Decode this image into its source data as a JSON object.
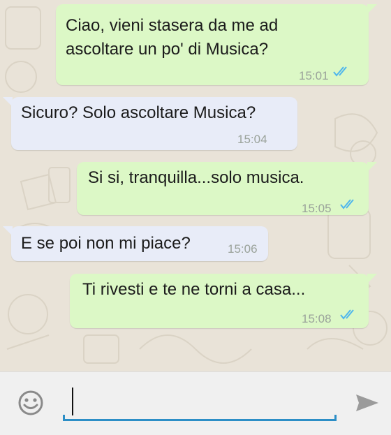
{
  "messages": [
    {
      "direction": "outgoing",
      "lines": [
        "Ciao, vieni stasera da me ad",
        "ascoltare un po' di Musica?"
      ],
      "time": "15:01",
      "status": "read"
    },
    {
      "direction": "incoming",
      "lines": [
        "Sicuro? Solo ascoltare Musica?"
      ],
      "time": "15:04"
    },
    {
      "direction": "outgoing",
      "lines": [
        "Si si, tranquilla...solo musica."
      ],
      "time": "15:05",
      "status": "read"
    },
    {
      "direction": "incoming",
      "lines": [
        "E se poi non mi piace?"
      ],
      "time": "15:06"
    },
    {
      "direction": "outgoing",
      "lines": [
        "Ti rivesti e te ne torni a casa..."
      ],
      "time": "15:08",
      "status": "read"
    }
  ],
  "composer": {
    "value": "",
    "emoji_icon": "smiley-icon",
    "send_icon": "send-icon"
  },
  "colors": {
    "outgoing_bubble": "#dcf8c6",
    "incoming_bubble": "#e8ecf8",
    "read_ticks": "#4fb6ec",
    "accent_underline": "#2c8ec6"
  }
}
